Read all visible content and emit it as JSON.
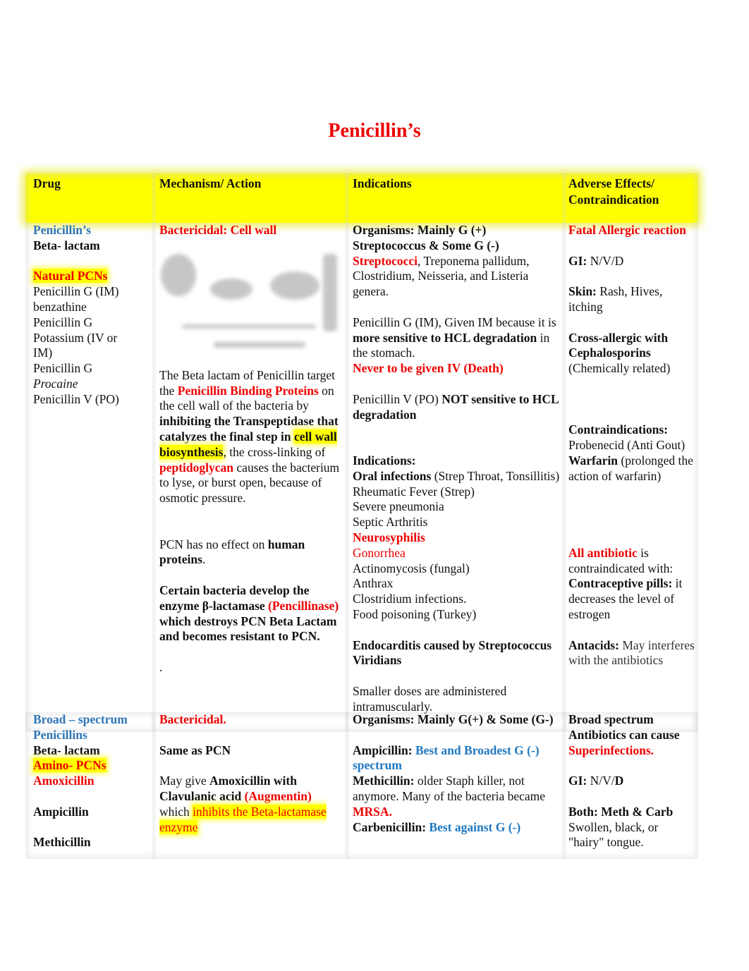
{
  "title": "Penicillin’s",
  "header": {
    "drug": "Drug",
    "mechanism": "Mechanism/ Action",
    "indications": "Indications",
    "adverse_line1": "Adverse Effects/",
    "adverse_line2": "Contraindication"
  },
  "row1": {
    "drug": {
      "class_name": "Penicillin’s",
      "type": "Beta- lactam",
      "group": "Natural PCNs",
      "items": [
        "Penicillin G (IM)",
        "benzathine",
        "Penicillin G",
        "Potassium (IV or",
        "IM)",
        "Penicillin G"
      ],
      "procaine": "Procaine",
      "last": "Penicillin V (PO)"
    },
    "mechanism": {
      "heading": "Bactericidal: Cell wall",
      "diagram_icon": "cell-wall-diagram-image",
      "p1_a": "The Beta lactam of Penicillin target the ",
      "p1_b": "Penicillin Binding Proteins",
      "p1_c": " on the cell wall of the bacteria by ",
      "p1_d": "inhibiting the Transpeptidase that catalyzes the final step in ",
      "p1_e": "cell wall biosynthesis",
      "p1_f": ", the cross-linking of ",
      "p1_g": "peptidoglycan",
      "p1_h": " causes the bacterium to lyse, or burst open, because of osmotic pressure.",
      "p2_a": "PCN has no effect on ",
      "p2_b": "human proteins",
      "p2_c": ".",
      "p3_a": "Certain bacteria develop the enzyme β-lactamase ",
      "p3_b": "(Pencillinase)",
      "p3_c": " which destroys PCN Beta Lactam and becomes resistant to PCN.",
      "p4": "."
    },
    "indications": {
      "org_a": "Organisms: Mainly G (+) Streptococcus & Some G (-)",
      "org_b": "Streptococci",
      "org_c": ", Treponema pallidum, Clostridium, Neisseria, and Listeria genera.",
      "pg_a": "Penicillin G (IM), Given IM because it is ",
      "pg_b": "more sensitive to HCL degradation",
      "pg_c": " in the stomach.",
      "pg_d": "Never to be given IV (Death)",
      "pv_a": "Penicillin V (PO) ",
      "pv_b": "NOT sensitive to HCL degradation",
      "ind_heading": "Indications:",
      "oral_a": "Oral infections",
      "oral_b": " (Strep Throat, Tonsillitis)",
      "list": [
        "Rheumatic Fever (Strep)",
        "Severe pneumonia",
        "Septic Arthritis"
      ],
      "neuro": "Neurosyphilis",
      "gono": "Gonorrhea",
      "list2": [
        "Actinomycosis (fungal)",
        "Anthrax",
        "Clostridium infections.",
        "Food poisoning (Turkey)"
      ],
      "endo": "Endocarditis caused by Streptococcus Viridians",
      "smaller": "Smaller doses are administered intramuscularly."
    },
    "adverse": {
      "fatal": "Fatal Allergic reaction",
      "gi_label": "GI:",
      "gi_value": " N/V/D",
      "skin_label": "Skin:",
      "skin_value": " Rash, Hives, itching",
      "cross": "Cross-allergic with Cephalosporins",
      "cross_note": "(Chemically related)",
      "contra_heading": "Contraindications:",
      "probenecid": "Probenecid (Anti Gout)",
      "warfarin_label": "Warfarin",
      "warfarin_note": " (prolonged the action of warfarin)",
      "all_a": "All antibiotic",
      "all_b": " is contraindicated with:",
      "contraceptive_label": "Contraceptive pills:",
      "contraceptive_note": " it decreases the level of estrogen",
      "antacids_label": "Antacids:",
      "antacids_note": " May interferes with the antibiotics"
    }
  },
  "row2": {
    "drug": {
      "class_name": "Broad – spectrum Penicillins",
      "type": "Beta- lactam",
      "group": "Amino- PCNs",
      "amox": "Amoxicillin",
      "ampi": "Ampicillin",
      "meth": "Methicillin"
    },
    "mechanism": {
      "heading": "Bactericidal.",
      "same": "Same as PCN",
      "may_a": "May give ",
      "may_b": "Amoxicillin with Clavulanic acid",
      "may_c": " ",
      "may_d": "(Augmentin)",
      "may_e": " which ",
      "may_f": "inhibits the Beta-lactamase enzyme"
    },
    "indications": {
      "org": "Organisms: Mainly G(+) &  Some (G-)",
      "ampi_label": "Ampicillin:",
      "ampi_value": " Best and Broadest G (-) spectrum",
      "meth_label": "Methicillin:",
      "meth_value": " older Staph killer, not anymore. Many of the bacteria became ",
      "mrsa": "MRSA.",
      "carb_label": "Carbenicillin:",
      "carb_value": " Best against G (-)"
    },
    "adverse": {
      "broad": "Broad spectrum Antibiotics can cause ",
      "super": "Superinfections.",
      "gi_label": "GI:",
      "gi_value": " N/V/",
      "gi_d": "D",
      "both": "Both: Meth & Carb",
      "tongue": "Swollen, black, or \"hairy\" tongue."
    }
  }
}
